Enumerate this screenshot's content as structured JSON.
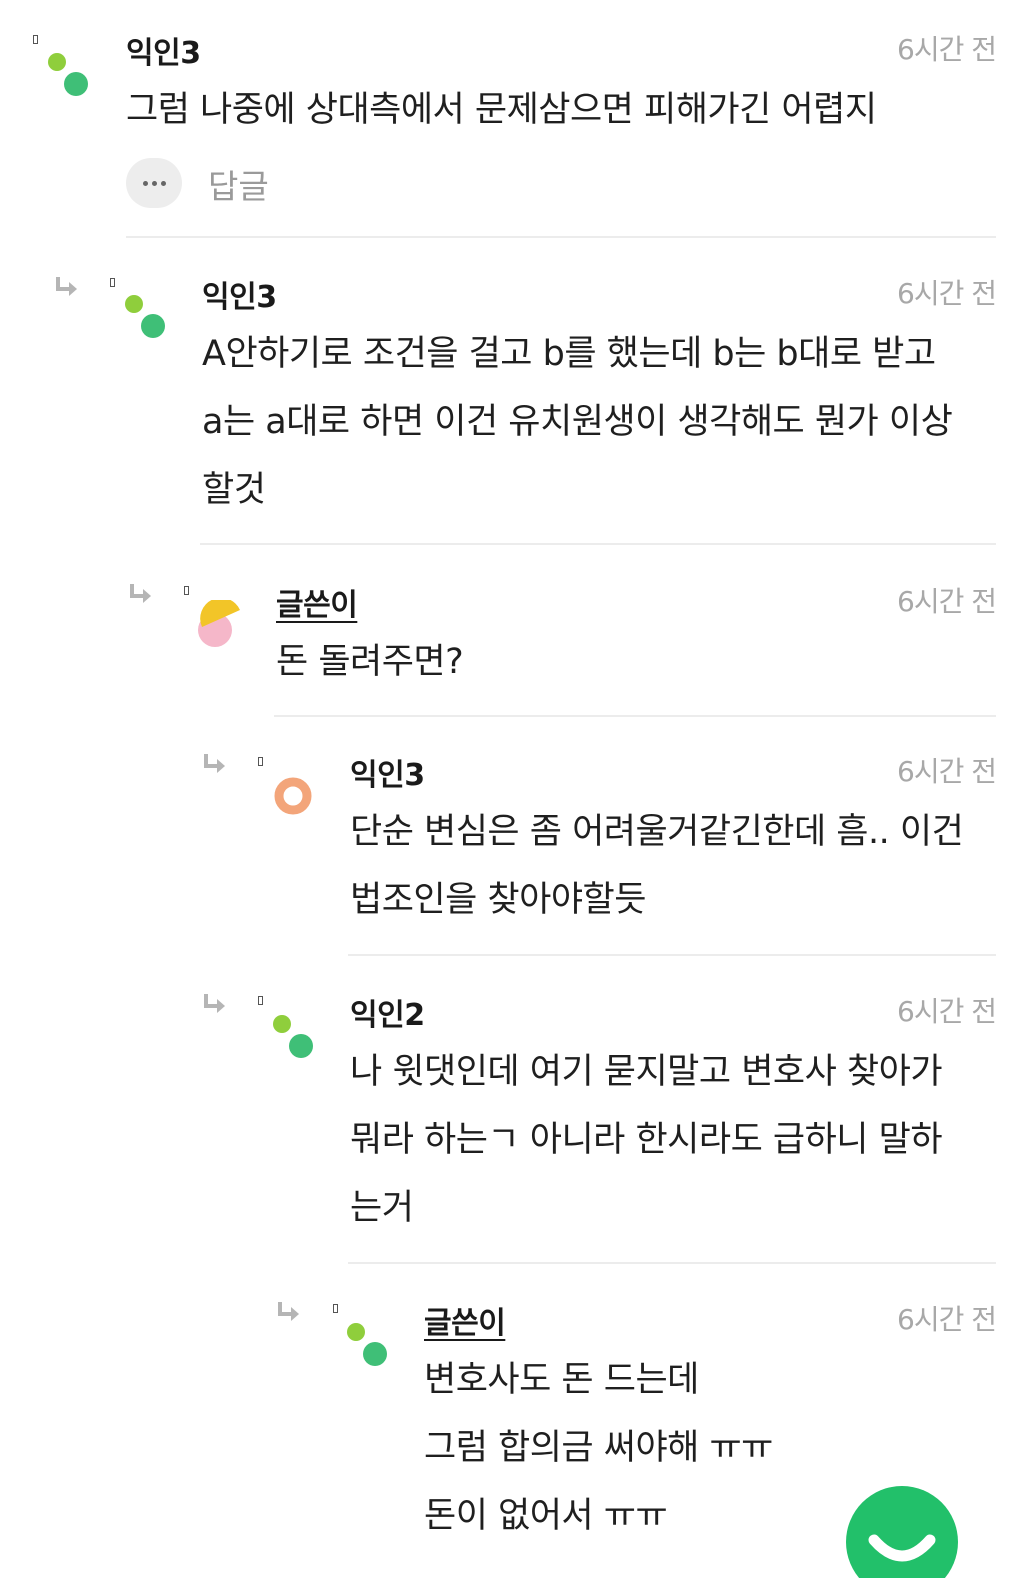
{
  "comments": [
    {
      "author": "익인3",
      "time": "6시간 전",
      "text": "그럼 나중에 상대측에서 문제삼으면 피해가긴 어렵지",
      "reply_label": "답글",
      "avatar": "green-dots",
      "is_op": false
    },
    {
      "author": "익인3",
      "time": "6시간 전",
      "text": "A안하기로 조건을 걸고 b를 했는데 b는 b대로 받고\na는 a대로 하면 이건 유치원생이 생각해도 뭔가 이상\n할것",
      "avatar": "green-dots",
      "is_op": false
    },
    {
      "author": "글쓴이",
      "time": "6시간 전",
      "text": "돈 돌려주면?",
      "avatar": "yellow-pink",
      "is_op": true
    },
    {
      "author": "익인3",
      "time": "6시간 전",
      "text": "단순 변심은 좀 어려울거같긴한데 흠.. 이건\n법조인을 찾아야할듯",
      "avatar": "orange-ring",
      "is_op": false
    },
    {
      "author": "익인2",
      "time": "6시간 전",
      "text": "나 윗댓인데 여기 묻지말고 변호사 찾아가\n뭐라 하는ㄱ 아니라 한시라도 급하니 말하\n는거",
      "avatar": "green-dots",
      "is_op": false
    },
    {
      "author": "글쓴이",
      "time": "6시간 전",
      "text": "변호사도 돈 드는데\n그럼 합의금 써야해 ㅠㅠ\n돈이 없어서 ㅠㅠ",
      "avatar": "green-dots",
      "is_op": true
    }
  ],
  "icons": {
    "reply_arrow": "reply-arrow-icon",
    "more": "more-dots-icon",
    "fab": "smile-icon"
  },
  "colors": {
    "accent_green": "#22c06a",
    "divider": "#ececec",
    "meta_gray": "#a8a8a8"
  }
}
